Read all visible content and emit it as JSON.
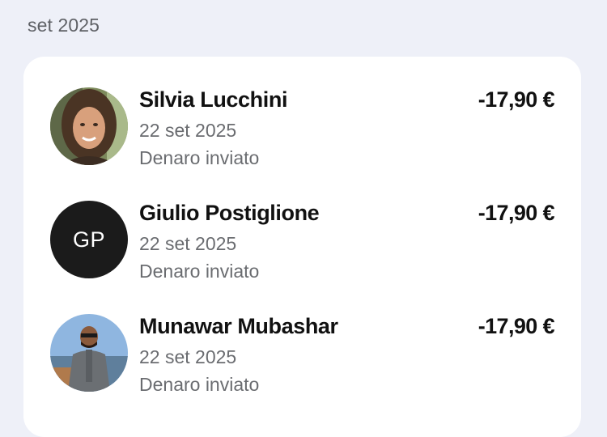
{
  "section": {
    "label": "set 2025"
  },
  "transactions": [
    {
      "name": "Silvia Lucchini",
      "date": "22 set 2025",
      "status": "Denaro inviato",
      "amount": "-17,90 €",
      "avatar": "photo-woman"
    },
    {
      "name": "Giulio Postiglione",
      "date": "22 set 2025",
      "status": "Denaro inviato",
      "amount": "-17,90 €",
      "avatar_initials": "GP"
    },
    {
      "name": "Munawar Mubashar",
      "date": "22 set 2025",
      "status": "Denaro inviato",
      "amount": "-17,90 €",
      "avatar": "photo-man"
    }
  ],
  "colors": {
    "background": "#eef0f8",
    "card": "#ffffff",
    "initials_avatar": "#1b1b1b"
  }
}
